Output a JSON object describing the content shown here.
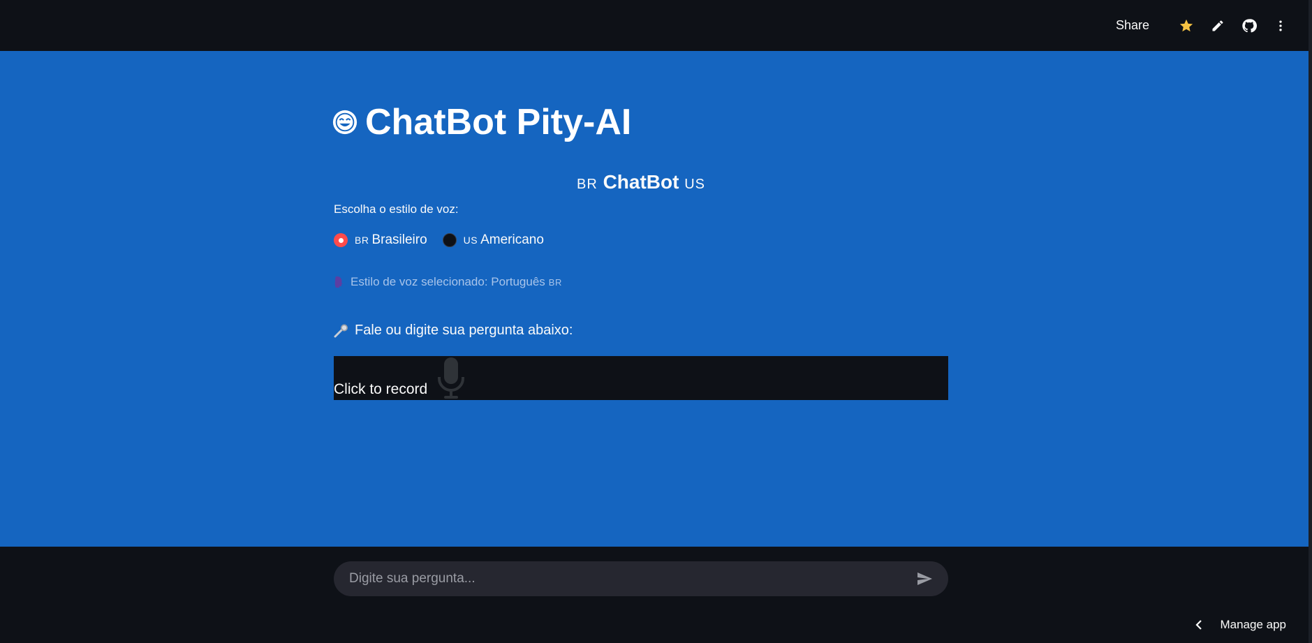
{
  "header": {
    "share_label": "Share",
    "icons": [
      "star-icon",
      "pencil-icon",
      "github-icon",
      "more-vertical-icon"
    ],
    "star_color": "#f6c343"
  },
  "main": {
    "background": "#1565c0",
    "title": "ChatBot Pity-AI",
    "title_icon": "smiling-face-icon",
    "subtitle": {
      "flag_left": "BR",
      "text": "ChatBot",
      "flag_right": "US"
    },
    "voice_label": "Escolha o estilo de voz:",
    "voice_options": [
      {
        "flag": "BR",
        "label": "Brasileiro",
        "selected": true
      },
      {
        "flag": "US",
        "label": "Americano",
        "selected": false
      }
    ],
    "selected_voice": {
      "icon": "speaking-head-icon",
      "text": "Estilo de voz selecionado: Português",
      "flag": "BR"
    },
    "ask_label": {
      "icon": "microphone-emoji-icon",
      "text": "Fale ou digite sua pergunta abaixo:"
    },
    "recorder": {
      "label": "Click to record",
      "icon": "microphone-icon"
    }
  },
  "footer": {
    "chat_placeholder": "Digite sua pergunta...",
    "send_icon": "send-icon",
    "manage_label": "Manage app"
  },
  "colors": {
    "dark_bg": "#0e1117",
    "accent_radio": "#ff4b4b",
    "input_bg": "#262730"
  }
}
